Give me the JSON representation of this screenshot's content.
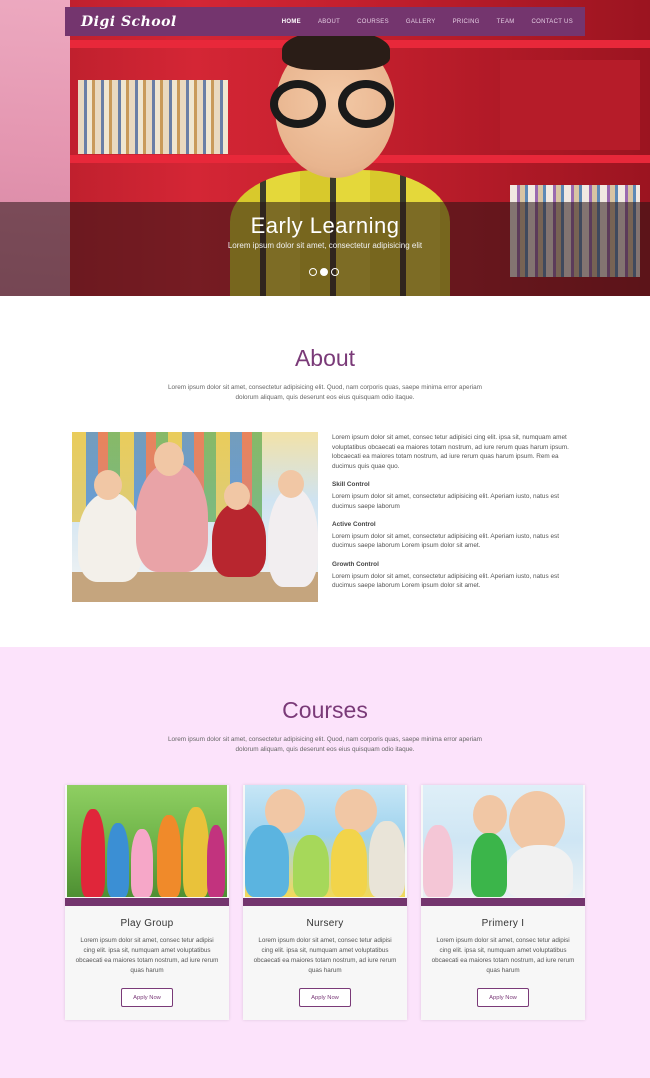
{
  "nav": {
    "logo": "Digi School",
    "items": [
      {
        "label": "HOME",
        "active": true
      },
      {
        "label": "ABOUT"
      },
      {
        "label": "COURSES"
      },
      {
        "label": "GALLERY"
      },
      {
        "label": "PRICING"
      },
      {
        "label": "TEAM"
      },
      {
        "label": "CONTACT US"
      }
    ]
  },
  "hero": {
    "title": "Early Learning",
    "subtitle": "Lorem ipsum dolor sit amet, consectetur adipisicing elit",
    "slides": 3,
    "active_slide": 1
  },
  "about": {
    "title": "About",
    "lead": "Lorem ipsum dolor sit amet, consectetur adipisicing elit. Quod, nam corporis quas, saepe minima error aperiam dolorum aliquam, quis deserunt eos eius quisquam odio itaque.",
    "intro": "Lorem ipsum dolor sit amet, consec tetur adipisici cing elit. ipsa sit, numquam amet voluptatibus obcaecati ea maiores totam nostrum, ad iure rerum quas harum ipsum. lobcaecati ea maiores totam nostrum, ad iure rerum quas harum ipsum. Rem ea ducimus quis quae quo.",
    "items": [
      {
        "title": "Skill Control",
        "text": "Lorem ipsum dolor sit amet, consectetur adipisicing elit. Aperiam iusto, natus est ducimus saepe laborum"
      },
      {
        "title": "Active Control",
        "text": "Lorem ipsum dolor sit amet, consectetur adipisicing elit. Aperiam iusto, natus est ducimus saepe laborum Lorem ipsum dolor sit amet."
      },
      {
        "title": "Growth Control",
        "text": "Lorem ipsum dolor sit amet, consectetur adipisicing elit. Aperiam iusto, natus est ducimus saepe laborum Lorem ipsum dolor sit amet."
      }
    ]
  },
  "courses": {
    "title": "Courses",
    "lead": "Lorem ipsum dolor sit amet, consectetur adipisicing elit. Quod, nam corporis quas, saepe minima error aperiam dolorum aliquam, quis deserunt eos eius quisquam odio itaque.",
    "cards": [
      {
        "title": "Play Group",
        "text": "Lorem ipsum dolor sit amet, consec tetur adipisi cing elit. ipsa sit, numquam amet voluptatibus obcaecati ea maiores totam nostrum, ad iure rerum quas harum",
        "button": "Apply Now"
      },
      {
        "title": "Nursery",
        "text": "Lorem ipsum dolor sit amet, consec tetur adipisi cing elit. ipsa sit, numquam amet voluptatibus obcaecati ea maiores totam nostrum, ad iure rerum quas harum",
        "button": "Apply Now"
      },
      {
        "title": "Primery I",
        "text": "Lorem ipsum dolor sit amet, consec tetur adipisi cing elit. ipsa sit, numquam amet voluptatibus obcaecati ea maiores totam nostrum, ad iure rerum quas harum",
        "button": "Apply Now"
      }
    ]
  },
  "colors": {
    "brand": "#74356e",
    "heading": "#7a3a78",
    "courses_bg": "#fce3fb"
  }
}
